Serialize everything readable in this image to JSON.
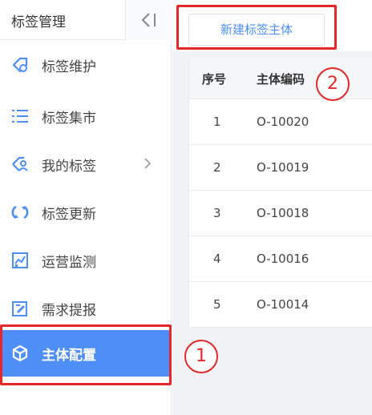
{
  "sidebar": {
    "title": "标签管理",
    "collapse_glyph": "<|",
    "items": [
      {
        "label": "标签维护",
        "icon": "tag-gear-icon",
        "color": "#4d8ff7"
      },
      {
        "label": "标签集市",
        "icon": "list-icon",
        "color": "#4d8ff7"
      },
      {
        "label": "我的标签",
        "icon": "user-tag-icon",
        "color": "#4d8ff7",
        "has_submenu": true
      },
      {
        "label": "标签更新",
        "icon": "refresh-icon",
        "color": "#4d8ff7"
      },
      {
        "label": "运营监测",
        "icon": "chart-icon",
        "color": "#4d8ff7"
      },
      {
        "label": "需求提报",
        "icon": "edit-icon",
        "color": "#4d8ff7"
      },
      {
        "label": "主体配置",
        "icon": "cube-icon",
        "color": "#ffffff",
        "active": true
      }
    ]
  },
  "toolbar": {
    "new_button_label": "新建标签主体"
  },
  "table": {
    "columns": [
      "序号",
      "主体编码"
    ],
    "rows": [
      {
        "index": "1",
        "code": "O-10020"
      },
      {
        "index": "2",
        "code": "O-10019"
      },
      {
        "index": "3",
        "code": "O-10018"
      },
      {
        "index": "4",
        "code": "O-10016"
      },
      {
        "index": "5",
        "code": "O-10014"
      }
    ]
  },
  "annotations": [
    {
      "number": "1"
    },
    {
      "number": "2"
    }
  ],
  "colors": {
    "accent": "#4d8ff7",
    "highlight": "#e52727"
  }
}
